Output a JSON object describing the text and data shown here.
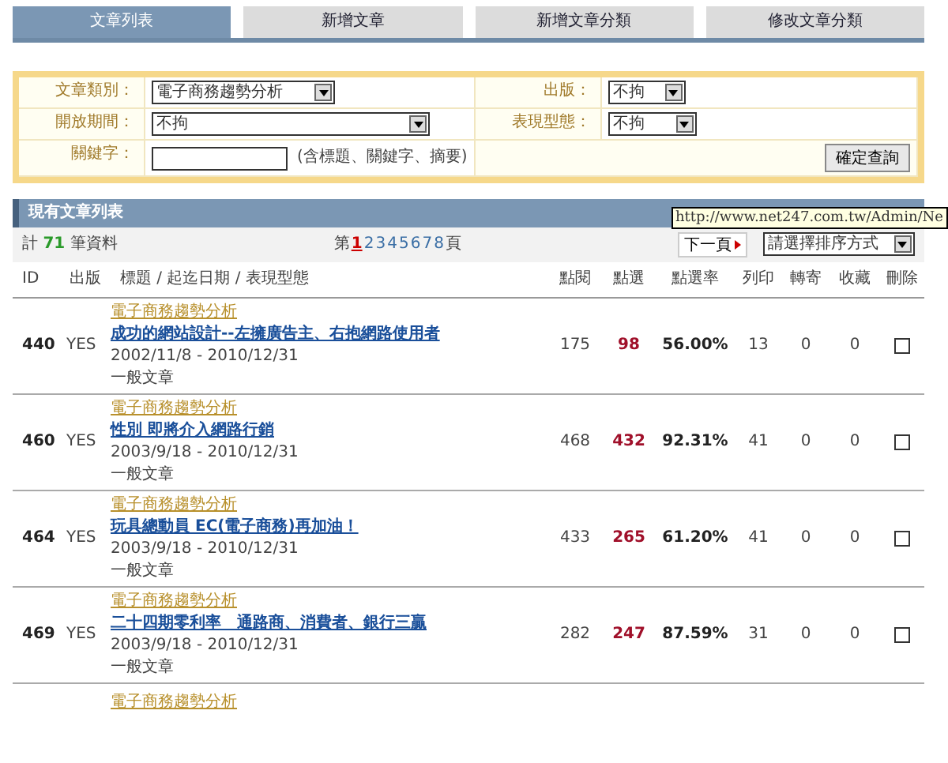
{
  "tabs": [
    {
      "label": "文章列表",
      "selected": true
    },
    {
      "label": "新增文章",
      "selected": false
    },
    {
      "label": "新增文章分類",
      "selected": false
    },
    {
      "label": "修改文章分類",
      "selected": false
    }
  ],
  "filters": {
    "category": {
      "label": "文章類別：",
      "value": "電子商務趨勢分析"
    },
    "publish": {
      "label": "出版：",
      "value": "不拘"
    },
    "period": {
      "label": "開放期間：",
      "value": "不拘"
    },
    "style": {
      "label": "表現型態：",
      "value": "不拘"
    },
    "keyword": {
      "label": "關鍵字：",
      "hint": "(含標題、關鍵字、摘要)"
    },
    "submit": "確定查詢"
  },
  "section_title": "現有文章列表",
  "summary": {
    "prefix": "計",
    "count": "71",
    "suffix": "筆資料"
  },
  "pagination": {
    "prefix": "第",
    "pages": [
      {
        "label": "1",
        "selected": true
      },
      {
        "label": "2",
        "selected": false
      },
      {
        "label": "3",
        "selected": false
      },
      {
        "label": "4",
        "selected": false
      },
      {
        "label": "5",
        "selected": false
      },
      {
        "label": "6",
        "selected": false
      },
      {
        "label": "7",
        "selected": false
      },
      {
        "label": "8",
        "selected": false
      }
    ],
    "suffix": "頁",
    "next": "下一頁",
    "sort": "請選擇排序方式"
  },
  "tooltip": "http://www.net247.com.tw/Admin/Ne",
  "columns": [
    "ID",
    "出版",
    "標題 / 起迄日期 / 表現型態",
    "點閱",
    "點選",
    "點選率",
    "列印",
    "轉寄",
    "收藏",
    "刪除"
  ],
  "rows": [
    {
      "id": "440",
      "published": "YES",
      "category": "電子商務趨勢分析",
      "title": "成功的網站設計--左擁廣告主、右抱網路使用者",
      "dates": "2002/11/8 - 2010/12/31",
      "type": "一般文章",
      "views": "175",
      "clicks": "98",
      "rate": "56.00%",
      "prints": "13",
      "forwards": "0",
      "favorites": "0",
      "checked": false
    },
    {
      "id": "460",
      "published": "YES",
      "category": "電子商務趨勢分析",
      "title": "性別 即將介入網路行銷",
      "dates": "2003/9/18 - 2010/12/31",
      "type": "一般文章",
      "views": "468",
      "clicks": "432",
      "rate": "92.31%",
      "prints": "41",
      "forwards": "0",
      "favorites": "0",
      "checked": false
    },
    {
      "id": "464",
      "published": "YES",
      "category": "電子商務趨勢分析",
      "title": "玩具總動員 EC(電子商務)再加油！",
      "dates": "2003/9/18 - 2010/12/31",
      "type": "一般文章",
      "views": "433",
      "clicks": "265",
      "rate": "61.20%",
      "prints": "41",
      "forwards": "0",
      "favorites": "0",
      "checked": false
    },
    {
      "id": "469",
      "published": "YES",
      "category": "電子商務趨勢分析",
      "title": "二十四期零利率　通路商、消費者、銀行三贏",
      "dates": "2003/9/18 - 2010/12/31",
      "type": "一般文章",
      "views": "282",
      "clicks": "247",
      "rate": "87.59%",
      "prints": "31",
      "forwards": "0",
      "favorites": "0",
      "checked": false
    }
  ],
  "partial_row": {
    "category": "電子商務趨勢分析"
  }
}
